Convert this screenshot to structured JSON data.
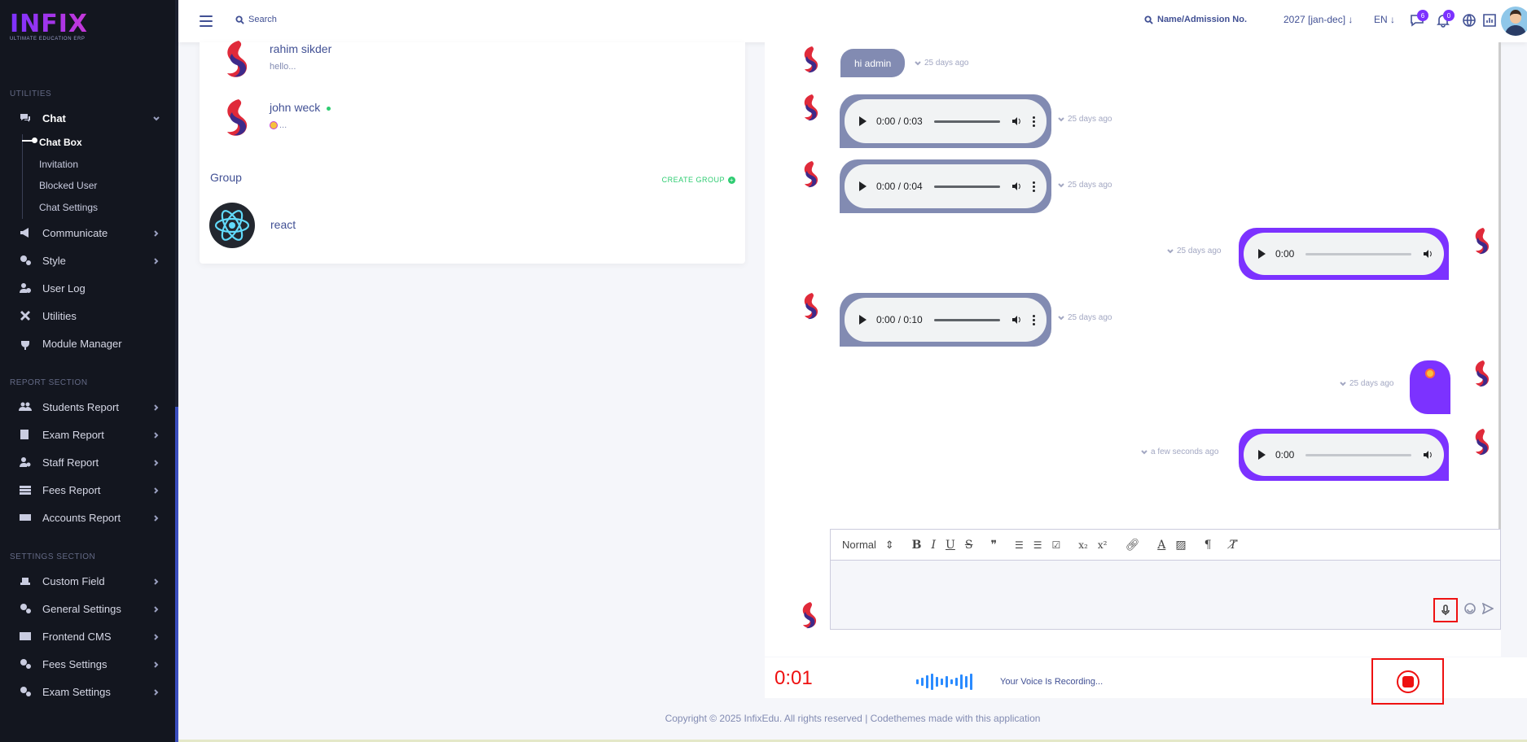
{
  "sidebar": {
    "logo_text": "INFIX",
    "logo_tagline": "ULTIMATE EDUCATION ERP",
    "utilities_label": "UTILITIES",
    "report_label": "REPORT SECTION",
    "settings_label": "SETTINGS SECTION",
    "chat": "Chat",
    "chat_sub": [
      "Chat Box",
      "Invitation",
      "Blocked User",
      "Chat Settings"
    ],
    "items_utilities": [
      "Communicate",
      "Style",
      "User Log",
      "Utilities",
      "Module Manager"
    ],
    "items_report": [
      "Students Report",
      "Exam Report",
      "Staff Report",
      "Fees Report",
      "Accounts Report"
    ],
    "items_settings": [
      "Custom Field",
      "General Settings",
      "Frontend CMS",
      "Fees Settings",
      "Exam Settings"
    ]
  },
  "topbar": {
    "search": "Search",
    "search_student": "Name/Admission No.",
    "year": "2027 [jan-dec]",
    "lang": "EN",
    "badge_messages": "6",
    "badge_notifications": "0"
  },
  "contacts": [
    {
      "name": "rahim sikder",
      "preview": "hello..."
    },
    {
      "name": "john weck",
      "preview": "..."
    }
  ],
  "group": {
    "label": "Group",
    "create": "CREATE GROUP",
    "name": "react"
  },
  "messages": {
    "m1_text": "hi admin",
    "m1_time": "25 days ago",
    "m2_audio": "0:00 / 0:03",
    "m2_time": "25 days ago",
    "m3_audio": "0:00 / 0:04",
    "m3_time": "25 days ago",
    "m4_audio": "0:00",
    "m4_time": "25 days ago",
    "m5_audio": "0:00 / 0:10",
    "m5_time": "25 days ago",
    "m6_time": "25 days ago",
    "m7_audio": "0:00",
    "m7_time": "a few seconds ago"
  },
  "editor": {
    "format": "Normal"
  },
  "recording": {
    "time": "0:01",
    "message": "Your Voice Is Recording..."
  },
  "footer": "Copyright © 2025 InfixEdu. All rights reserved | Codethemes made with this application",
  "colors": {
    "accent": "#7c32ff",
    "incoming": "#828bb2",
    "record": "#ee1111"
  }
}
